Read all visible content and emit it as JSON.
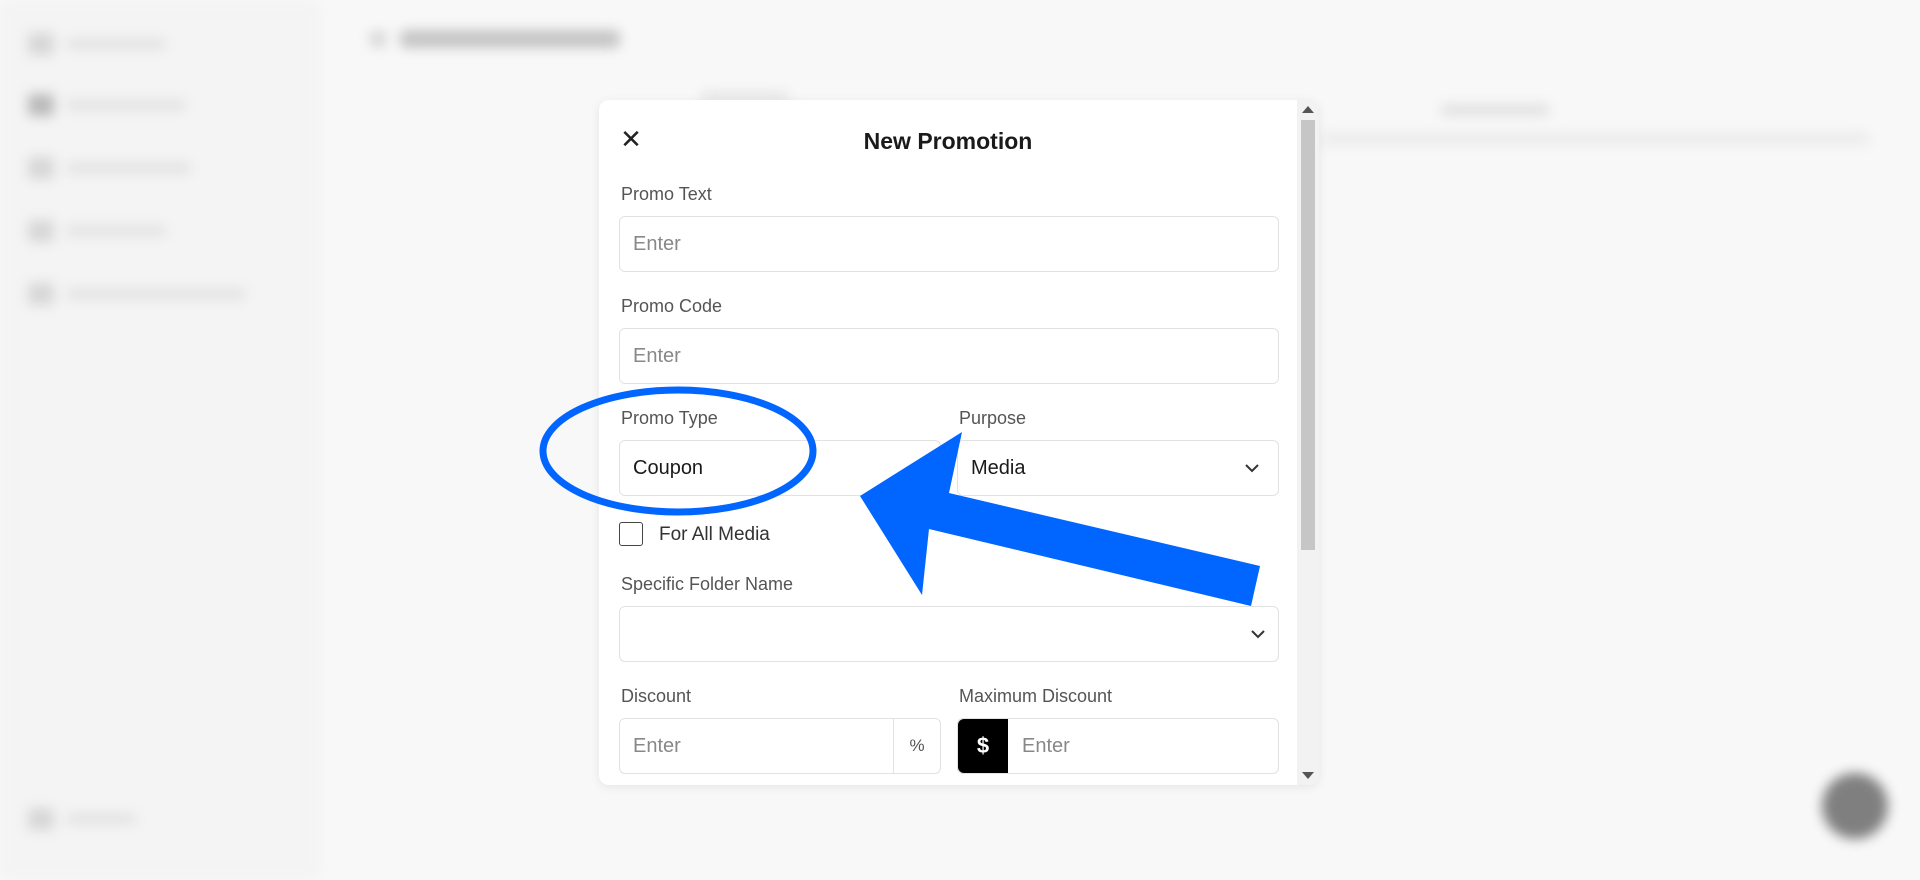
{
  "modal": {
    "title": "New Promotion",
    "close_icon": "close-icon",
    "promo_text": {
      "label": "Promo Text",
      "placeholder": "Enter"
    },
    "promo_code": {
      "label": "Promo Code",
      "placeholder": "Enter"
    },
    "promo_type": {
      "label": "Promo Type",
      "value": "Coupon"
    },
    "purpose": {
      "label": "Purpose",
      "value": "Media",
      "icon": "chevron-down-icon"
    },
    "for_all_media": {
      "label": "For All Media",
      "checked": false
    },
    "specific_folder": {
      "label": "Specific Folder Name",
      "value": "",
      "icon": "chevron-down-icon"
    },
    "discount": {
      "label": "Discount",
      "placeholder": "Enter",
      "suffix": "%"
    },
    "max_discount": {
      "label": "Maximum Discount",
      "placeholder": "Enter",
      "prefix": "$"
    }
  },
  "annotation": {
    "color": "#0066ff",
    "shapes": [
      "circle-highlight",
      "arrow"
    ]
  },
  "colors": {
    "page_bg": "#f8f8f8",
    "modal_bg": "#ffffff",
    "border": "#e2e2e2",
    "dollar_bg": "#000000"
  }
}
